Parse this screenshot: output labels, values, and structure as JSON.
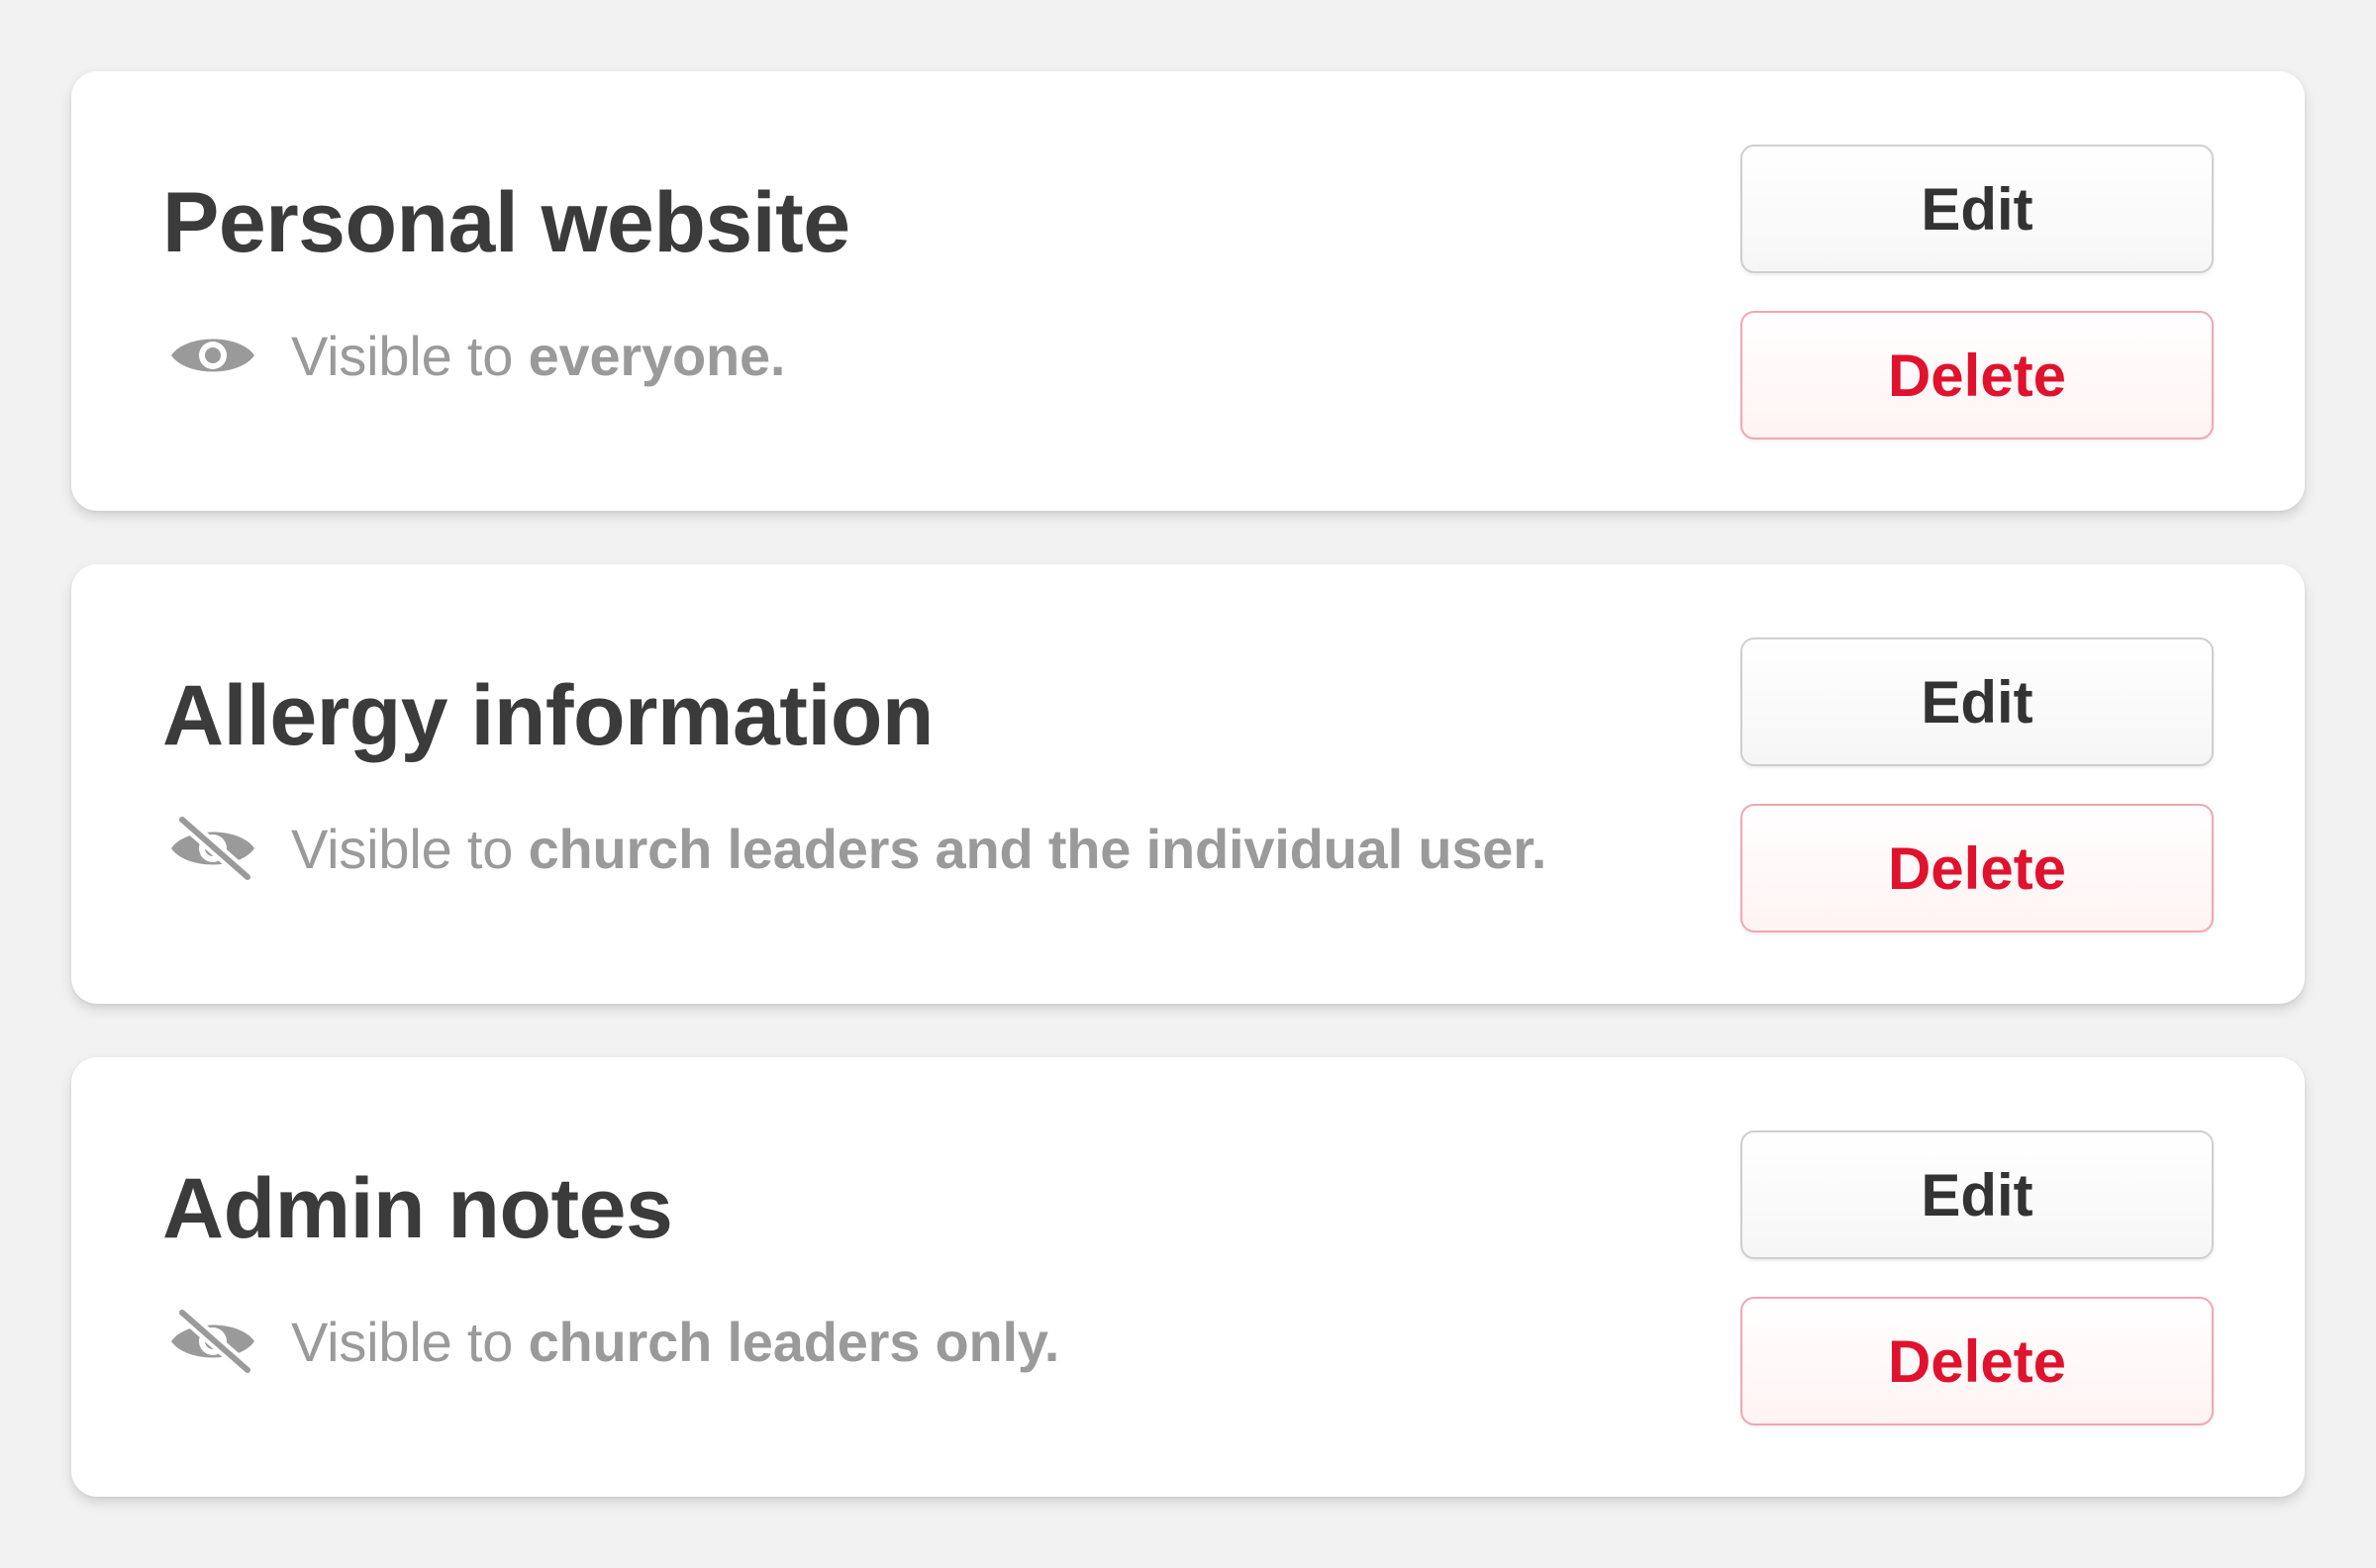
{
  "cards": [
    {
      "title": "Personal website",
      "visibility": {
        "icon": "eye-icon",
        "prefix": "Visible to ",
        "audience": "everyone.",
        "suffix": ""
      },
      "edit_label": "Edit",
      "delete_label": "Delete"
    },
    {
      "title": "Allergy information",
      "visibility": {
        "icon": "eye-slash-icon",
        "prefix": "Visible to ",
        "audience": "church leaders and the individual user.",
        "suffix": ""
      },
      "edit_label": "Edit",
      "delete_label": "Delete"
    },
    {
      "title": "Admin notes",
      "visibility": {
        "icon": "eye-slash-icon",
        "prefix": "Visible to ",
        "audience": "church leaders only.",
        "suffix": ""
      },
      "edit_label": "Edit",
      "delete_label": "Delete"
    }
  ],
  "colors": {
    "page_background": "#f2f2f2",
    "card_background": "#ffffff",
    "title_text": "#3b3b3b",
    "muted_text": "#9a9a9a",
    "delete_red": "#e0122d",
    "delete_border": "#f3a6ad",
    "edit_border": "#cfcfcf"
  }
}
